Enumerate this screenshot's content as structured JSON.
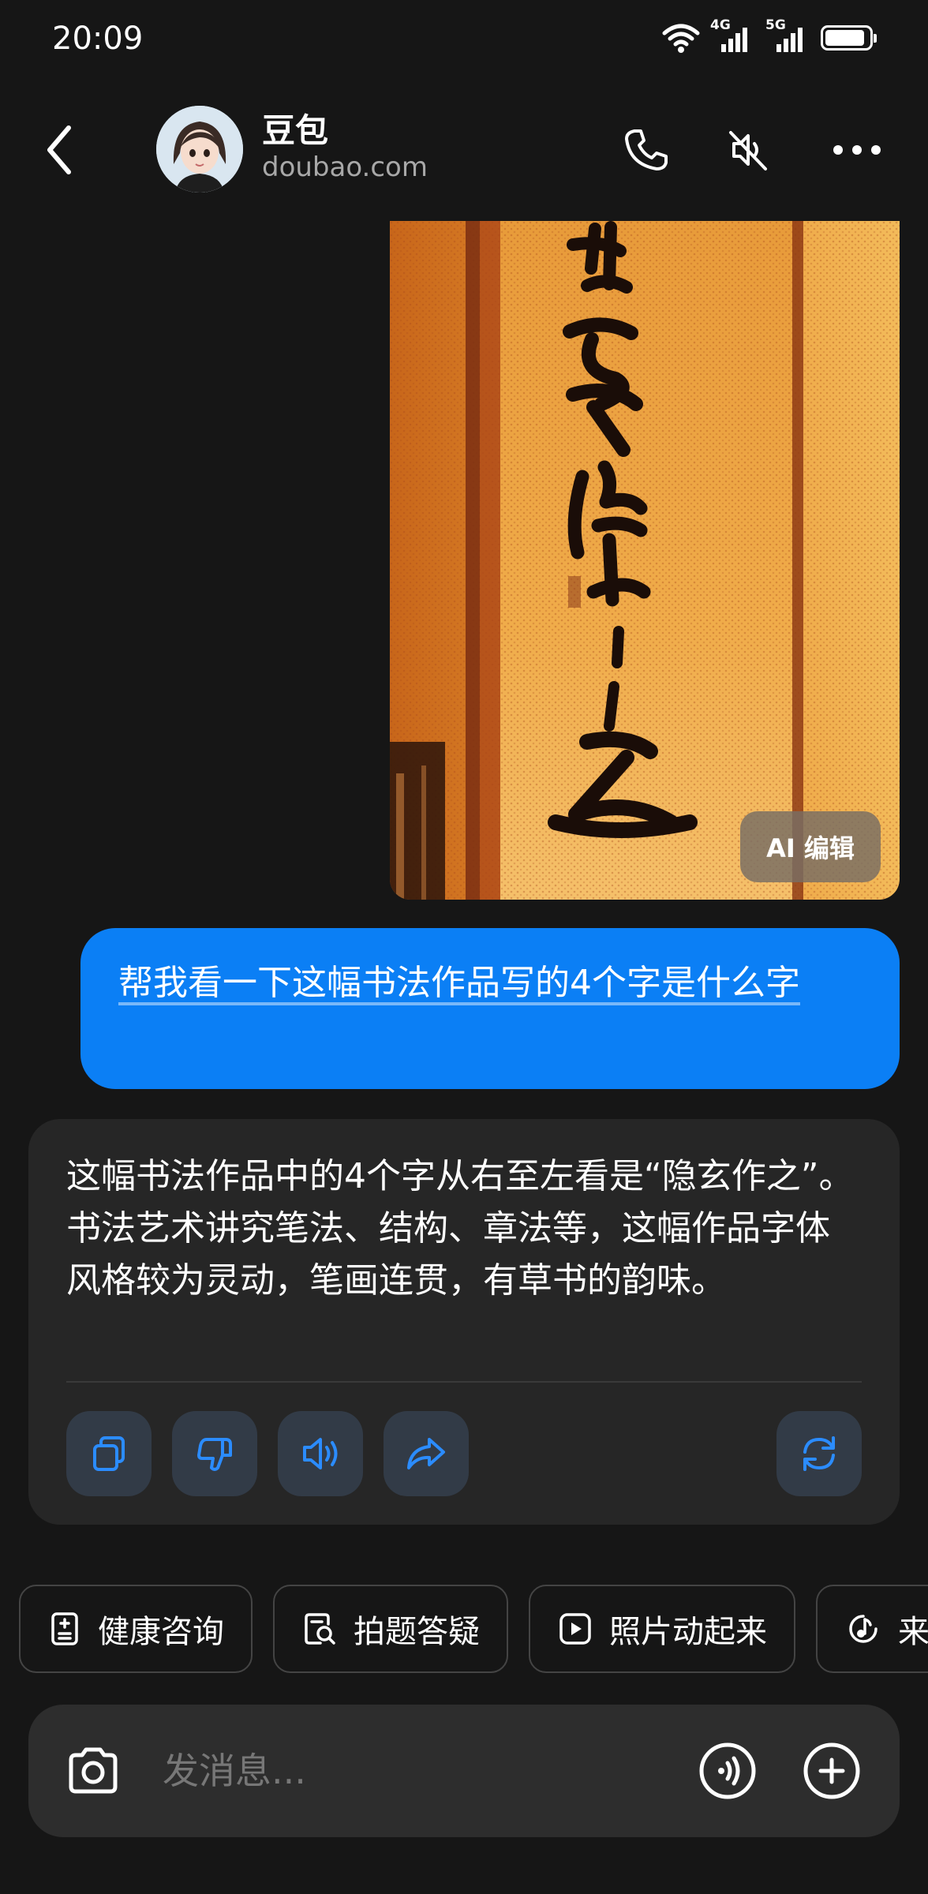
{
  "status_bar": {
    "time": "20:09",
    "net1": "4G",
    "net2": "5G",
    "battery_level": 0.9
  },
  "header": {
    "name": "豆包",
    "subtitle": "doubao.com"
  },
  "photo": {
    "edit_label": "AI 编辑"
  },
  "messages": {
    "user_text": "帮我看一下这幅书法作品写的4个字是什么字",
    "ai_text": "这幅书法作品中的4个字从右至左看是“隐玄作之”。书法艺术讲究笔法、结构、章法等，这幅作品字体风格较为灵动，笔画连贯，有草书的韵味。"
  },
  "chips": [
    {
      "label": "健康咨询",
      "icon": "health-record-icon"
    },
    {
      "label": "拍题答疑",
      "icon": "search-document-icon"
    },
    {
      "label": "照片动起来",
      "icon": "play-icon"
    },
    {
      "label": "来",
      "icon": "music-icon"
    }
  ],
  "input": {
    "placeholder": "发消息..."
  },
  "colors": {
    "background": "#161616",
    "user_bubble": "#0b7ff5",
    "ai_card": "#262626",
    "accent": "#2b8cff"
  }
}
